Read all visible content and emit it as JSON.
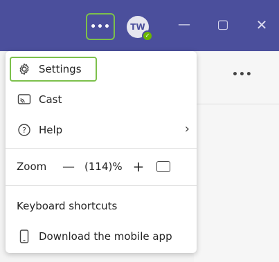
{
  "titlebar": {
    "more_label": "•••",
    "avatar_initials": "TW",
    "presence_mark": "✓",
    "min_label": "—",
    "max_label": "▢",
    "close_label": "✕"
  },
  "pane": {
    "more_label": "•••"
  },
  "menu": {
    "settings": "Settings",
    "cast": "Cast",
    "help": "Help",
    "help_chevron": "›",
    "zoom_label": "Zoom",
    "zoom_out": "—",
    "zoom_value": "(114)%",
    "zoom_in": "+",
    "keyboard_shortcuts": "Keyboard shortcuts",
    "download_mobile": "Download the mobile app"
  },
  "colors": {
    "titlebar": "#4b4f9c",
    "highlight": "#7cc04b",
    "presence": "#6bb700"
  },
  "icons": [
    "more-icon",
    "gear-icon",
    "cast-icon",
    "help-icon",
    "chevron-right-icon",
    "zoom-fit-icon",
    "phone-icon"
  ]
}
